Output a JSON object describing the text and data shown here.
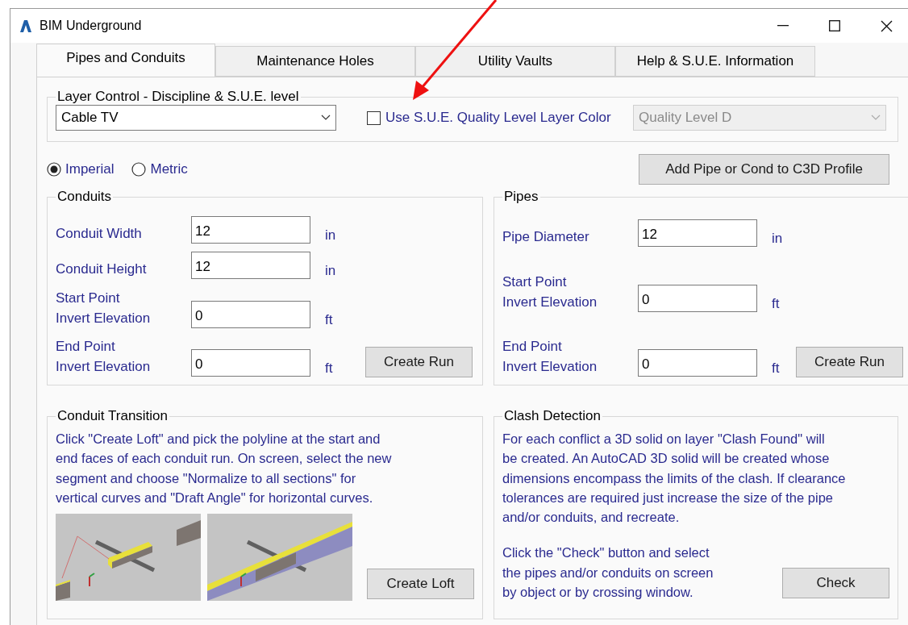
{
  "window": {
    "title": "BIM Underground"
  },
  "tabs": [
    {
      "label": "Pipes and Conduits",
      "selected": true
    },
    {
      "label": "Maintenance Holes",
      "selected": false
    },
    {
      "label": "Utility Vaults",
      "selected": false
    },
    {
      "label": "Help & S.U.E. Information",
      "selected": false
    }
  ],
  "layer_control": {
    "legend": "Layer Control - Discipline & S.U.E. level",
    "discipline": {
      "value": "Cable TV"
    },
    "quality_color": {
      "label": "Use S.U.E. Quality Level Layer Color",
      "checked": false
    },
    "quality_level": {
      "value": "Quality Level D",
      "disabled": true
    }
  },
  "units": [
    {
      "label": "Imperial",
      "selected": true
    },
    {
      "label": "Metric",
      "selected": false
    }
  ],
  "add_profile_button": "Add Pipe or Cond to C3D Profile",
  "conduits": {
    "legend": "Conduits",
    "button": "Create Run",
    "fields": [
      {
        "label": "Conduit Width",
        "value": "12",
        "unit": "in"
      },
      {
        "label": "Conduit Height",
        "value": "12",
        "unit": "in"
      },
      {
        "label": "Start Point\nInvert Elevation",
        "value": "0",
        "unit": "ft"
      },
      {
        "label": "End Point\nInvert Elevation",
        "value": "0",
        "unit": "ft"
      }
    ]
  },
  "pipes": {
    "legend": "Pipes",
    "button": "Create Run",
    "fields": [
      {
        "label": "Pipe Diameter",
        "value": "12",
        "unit": "in"
      },
      {
        "label": "Start Point\nInvert Elevation",
        "value": "0",
        "unit": "ft"
      },
      {
        "label": "End Point\nInvert Elevation",
        "value": "0",
        "unit": "ft"
      }
    ]
  },
  "conduit_transition": {
    "legend": "Conduit Transition",
    "text": "Click \"Create Loft\" and pick the polyline at the start and\nend faces of each conduit run. On screen, select the new\nsegment and choose \"Normalize to all sections\" for\nvertical curves and \"Draft Angle\" for horizontal curves.",
    "button": "Create Loft"
  },
  "clash_detection": {
    "legend": "Clash Detection",
    "text": "For each conflict a 3D solid on layer \"Clash Found\" will\nbe created. An AutoCAD 3D solid will be created whose\ndimensions encompass the limits of the clash. If clearance\ntolerances are required just increase the size of the pipe\nand/or conduits, and recreate.",
    "instructions": "Click the \"Check\" button and select\nthe pipes and/or conduits on screen\nby object or by crossing window.",
    "button": "Check"
  }
}
